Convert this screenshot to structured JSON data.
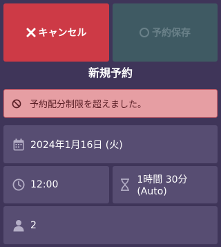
{
  "actions": {
    "cancel_label": "キャンセル",
    "save_label": "予約保存"
  },
  "page": {
    "title": "新規予約"
  },
  "alert": {
    "message": "予約配分制限を超えました。"
  },
  "form": {
    "date_value": "2024年1月16日 (火)",
    "time_value": "12:00",
    "duration_value": "1時間 30分 (Auto)",
    "party_size_value": "2"
  },
  "colors": {
    "background": "#3f3559",
    "cancel": "#cd3a46",
    "save_disabled": "#3f5a63",
    "alert_bg": "#e69ea3",
    "field_bg": "#574d72"
  },
  "icons": [
    "x-icon",
    "circle-icon",
    "ban-icon",
    "calendar-icon",
    "clock-icon",
    "hourglass-icon",
    "person-icon"
  ]
}
